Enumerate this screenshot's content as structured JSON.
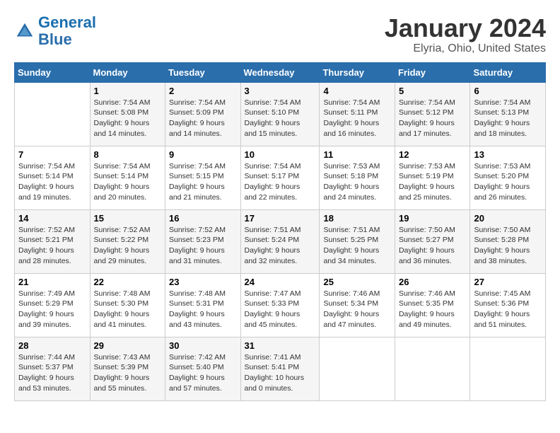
{
  "logo": {
    "line1": "General",
    "line2": "Blue"
  },
  "title": "January 2024",
  "subtitle": "Elyria, Ohio, United States",
  "days_of_week": [
    "Sunday",
    "Monday",
    "Tuesday",
    "Wednesday",
    "Thursday",
    "Friday",
    "Saturday"
  ],
  "weeks": [
    [
      {
        "day": "",
        "info": ""
      },
      {
        "day": "1",
        "info": "Sunrise: 7:54 AM\nSunset: 5:08 PM\nDaylight: 9 hours\nand 14 minutes."
      },
      {
        "day": "2",
        "info": "Sunrise: 7:54 AM\nSunset: 5:09 PM\nDaylight: 9 hours\nand 14 minutes."
      },
      {
        "day": "3",
        "info": "Sunrise: 7:54 AM\nSunset: 5:10 PM\nDaylight: 9 hours\nand 15 minutes."
      },
      {
        "day": "4",
        "info": "Sunrise: 7:54 AM\nSunset: 5:11 PM\nDaylight: 9 hours\nand 16 minutes."
      },
      {
        "day": "5",
        "info": "Sunrise: 7:54 AM\nSunset: 5:12 PM\nDaylight: 9 hours\nand 17 minutes."
      },
      {
        "day": "6",
        "info": "Sunrise: 7:54 AM\nSunset: 5:13 PM\nDaylight: 9 hours\nand 18 minutes."
      }
    ],
    [
      {
        "day": "7",
        "info": "Sunrise: 7:54 AM\nSunset: 5:14 PM\nDaylight: 9 hours\nand 19 minutes."
      },
      {
        "day": "8",
        "info": "Sunrise: 7:54 AM\nSunset: 5:14 PM\nDaylight: 9 hours\nand 20 minutes."
      },
      {
        "day": "9",
        "info": "Sunrise: 7:54 AM\nSunset: 5:15 PM\nDaylight: 9 hours\nand 21 minutes."
      },
      {
        "day": "10",
        "info": "Sunrise: 7:54 AM\nSunset: 5:17 PM\nDaylight: 9 hours\nand 22 minutes."
      },
      {
        "day": "11",
        "info": "Sunrise: 7:53 AM\nSunset: 5:18 PM\nDaylight: 9 hours\nand 24 minutes."
      },
      {
        "day": "12",
        "info": "Sunrise: 7:53 AM\nSunset: 5:19 PM\nDaylight: 9 hours\nand 25 minutes."
      },
      {
        "day": "13",
        "info": "Sunrise: 7:53 AM\nSunset: 5:20 PM\nDaylight: 9 hours\nand 26 minutes."
      }
    ],
    [
      {
        "day": "14",
        "info": "Sunrise: 7:52 AM\nSunset: 5:21 PM\nDaylight: 9 hours\nand 28 minutes."
      },
      {
        "day": "15",
        "info": "Sunrise: 7:52 AM\nSunset: 5:22 PM\nDaylight: 9 hours\nand 29 minutes."
      },
      {
        "day": "16",
        "info": "Sunrise: 7:52 AM\nSunset: 5:23 PM\nDaylight: 9 hours\nand 31 minutes."
      },
      {
        "day": "17",
        "info": "Sunrise: 7:51 AM\nSunset: 5:24 PM\nDaylight: 9 hours\nand 32 minutes."
      },
      {
        "day": "18",
        "info": "Sunrise: 7:51 AM\nSunset: 5:25 PM\nDaylight: 9 hours\nand 34 minutes."
      },
      {
        "day": "19",
        "info": "Sunrise: 7:50 AM\nSunset: 5:27 PM\nDaylight: 9 hours\nand 36 minutes."
      },
      {
        "day": "20",
        "info": "Sunrise: 7:50 AM\nSunset: 5:28 PM\nDaylight: 9 hours\nand 38 minutes."
      }
    ],
    [
      {
        "day": "21",
        "info": "Sunrise: 7:49 AM\nSunset: 5:29 PM\nDaylight: 9 hours\nand 39 minutes."
      },
      {
        "day": "22",
        "info": "Sunrise: 7:48 AM\nSunset: 5:30 PM\nDaylight: 9 hours\nand 41 minutes."
      },
      {
        "day": "23",
        "info": "Sunrise: 7:48 AM\nSunset: 5:31 PM\nDaylight: 9 hours\nand 43 minutes."
      },
      {
        "day": "24",
        "info": "Sunrise: 7:47 AM\nSunset: 5:33 PM\nDaylight: 9 hours\nand 45 minutes."
      },
      {
        "day": "25",
        "info": "Sunrise: 7:46 AM\nSunset: 5:34 PM\nDaylight: 9 hours\nand 47 minutes."
      },
      {
        "day": "26",
        "info": "Sunrise: 7:46 AM\nSunset: 5:35 PM\nDaylight: 9 hours\nand 49 minutes."
      },
      {
        "day": "27",
        "info": "Sunrise: 7:45 AM\nSunset: 5:36 PM\nDaylight: 9 hours\nand 51 minutes."
      }
    ],
    [
      {
        "day": "28",
        "info": "Sunrise: 7:44 AM\nSunset: 5:37 PM\nDaylight: 9 hours\nand 53 minutes."
      },
      {
        "day": "29",
        "info": "Sunrise: 7:43 AM\nSunset: 5:39 PM\nDaylight: 9 hours\nand 55 minutes."
      },
      {
        "day": "30",
        "info": "Sunrise: 7:42 AM\nSunset: 5:40 PM\nDaylight: 9 hours\nand 57 minutes."
      },
      {
        "day": "31",
        "info": "Sunrise: 7:41 AM\nSunset: 5:41 PM\nDaylight: 10 hours\nand 0 minutes."
      },
      {
        "day": "",
        "info": ""
      },
      {
        "day": "",
        "info": ""
      },
      {
        "day": "",
        "info": ""
      }
    ]
  ]
}
